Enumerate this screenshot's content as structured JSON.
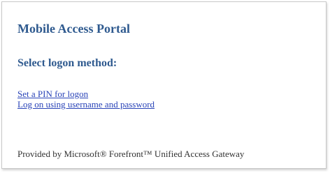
{
  "portal": {
    "title": "Mobile Access Portal",
    "heading": "Select logon method:"
  },
  "logon_methods": [
    {
      "label": "Set a PIN for logon"
    },
    {
      "label": "Log on using username and password"
    }
  ],
  "footer": {
    "text": "Provided by Microsoft® Forefront™ Unified Access Gateway"
  },
  "colors": {
    "heading": "#2f5a8f",
    "link": "#2a44b8",
    "footer_text": "#333333",
    "border": "#c8c8c8"
  }
}
